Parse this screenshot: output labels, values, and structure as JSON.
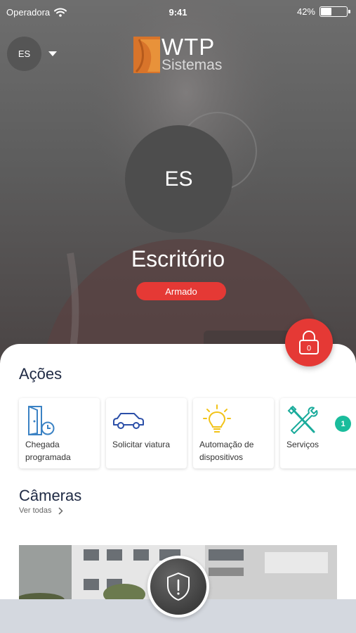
{
  "status_bar": {
    "carrier": "Operadora",
    "time": "9:41",
    "battery": "42%",
    "battery_level": 0.42
  },
  "header": {
    "account_initials": "ES",
    "logo_word_1": "WTP",
    "logo_word_2": "Sistemas"
  },
  "site": {
    "initials": "ES",
    "name": "Escritório",
    "status": "Armado",
    "status_color": "#e53935"
  },
  "lock_button": {
    "count": "0"
  },
  "actions": {
    "title": "Ações",
    "items": [
      {
        "label": "Chegada programada",
        "icon": "door-clock-icon"
      },
      {
        "label": "Solicitar viatura",
        "icon": "car-icon"
      },
      {
        "label": "Automação de dispositivos",
        "icon": "lightbulb-icon"
      },
      {
        "label": "Serviços",
        "icon": "tools-icon"
      }
    ],
    "badge": "1"
  },
  "cameras": {
    "title": "Câmeras",
    "see_all": "Ver todas"
  },
  "panic_button": {
    "icon": "shield-alert-icon"
  },
  "colors": {
    "accent_red": "#e53935",
    "badge_teal": "#1abc9c",
    "icon_blue": "#3b82c4",
    "icon_teal": "#1aab9b",
    "icon_yellow": "#f2c318",
    "title_navy": "#1f2a44"
  }
}
